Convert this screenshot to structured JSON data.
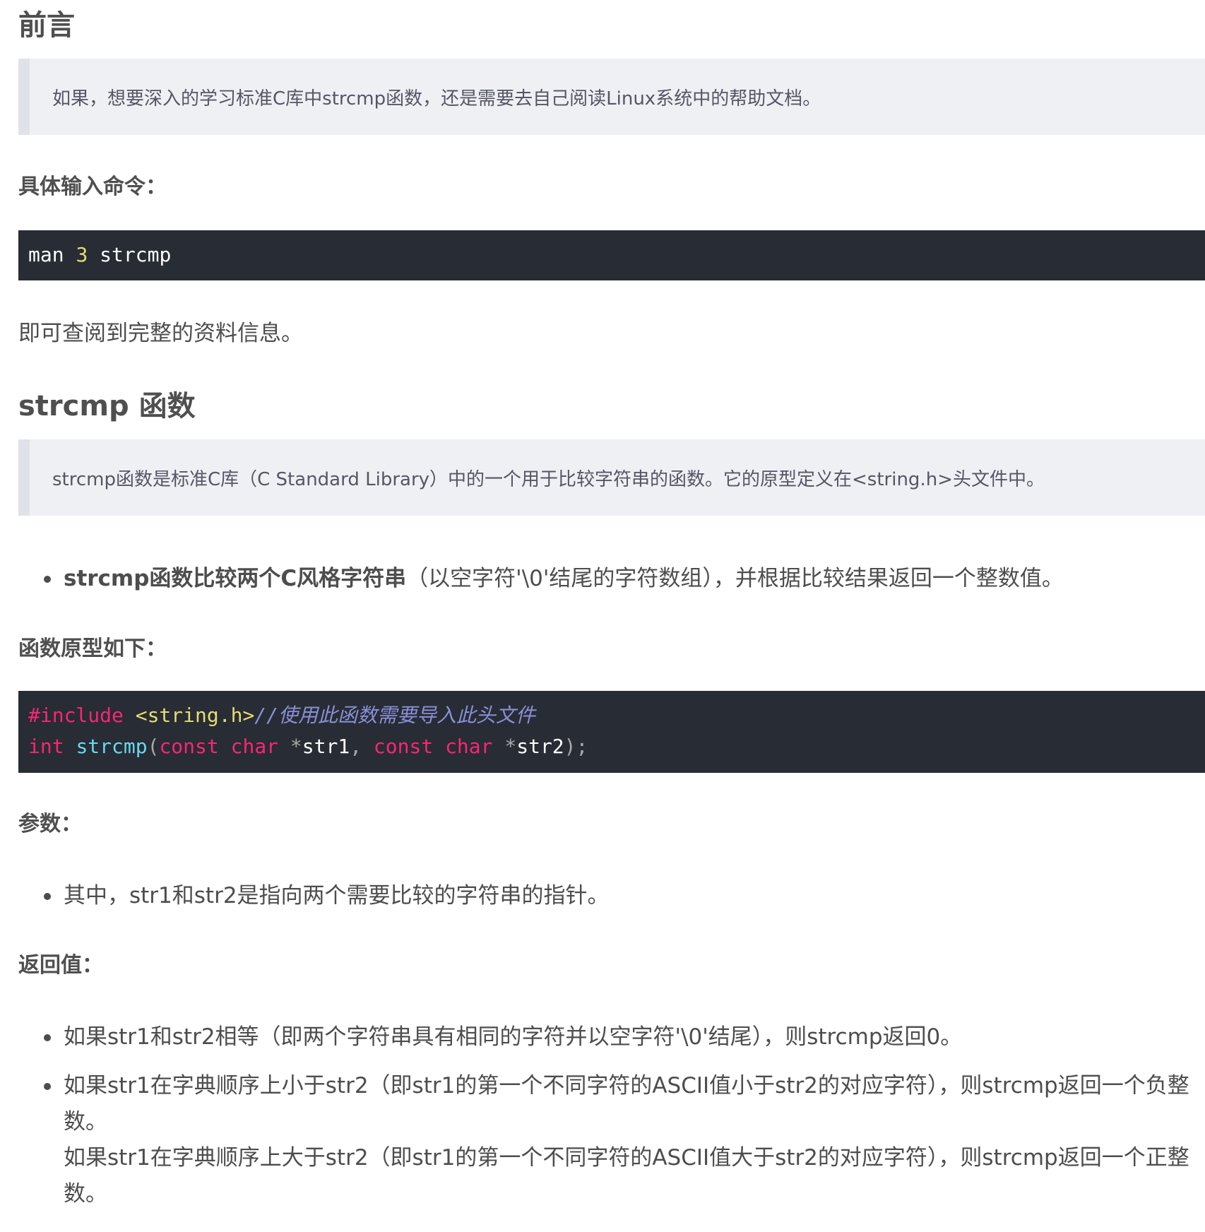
{
  "preface": {
    "title": "前言",
    "quote": "如果，想要深入的学习标准C库中strcmp函数，还是需要去自己阅读Linux系统中的帮助文档。",
    "command_label": "具体输入命令：",
    "command_code": {
      "cmd": "man",
      "section": "3",
      "arg": "strcmp"
    },
    "after_command": "即可查阅到完整的资料信息。"
  },
  "strcmp_section": {
    "title": "strcmp 函数",
    "quote": "strcmp函数是标准C库（C Standard Library）中的一个用于比较字符串的函数。它的原型定义在<string.h>头文件中。",
    "bullet_bold": "strcmp函数比较两个C风格字符串",
    "bullet_rest": "（以空字符'\\0'结尾的字符数组），并根据比较结果返回一个整数值。",
    "prototype_label": "函数原型如下：",
    "prototype_code": {
      "line1_directive": "#include",
      "line1_header": "<string.h>",
      "line1_comment": "//使用此函数需要导入此头文件",
      "line2_ret": "int",
      "line2_fn": "strcmp",
      "line2_open": "(",
      "line2_const1": "const",
      "line2_char1": "char",
      "line2_star1": "*",
      "line2_p1": "str1",
      "line2_comma": ",",
      "line2_const2": "const",
      "line2_char2": "char",
      "line2_star2": "*",
      "line2_p2": "str2",
      "line2_close": ");"
    },
    "params_label": "参数：",
    "params_item": "其中，str1和str2是指向两个需要比较的字符串的指针。",
    "return_label": "返回值：",
    "return_items": [
      "如果str1和str2相等（即两个字符串具有相同的字符并以空字符'\\0'结尾），则strcmp返回0。",
      "如果str1在字典顺序上小于str2（即str1的第一个不同字符的ASCII值小于str2的对应字符），则strcmp返回一个负整数。",
      "如果str1在字典顺序上大于str2（即str1的第一个不同字符的ASCII值大于str2的对应字符），则strcmp返回一个正整数。"
    ]
  },
  "colors": {
    "code_bg": "#282c34",
    "quote_bg": "#eef0f4",
    "quote_border": "#dfe2e8",
    "text": "#4d4d4d"
  }
}
